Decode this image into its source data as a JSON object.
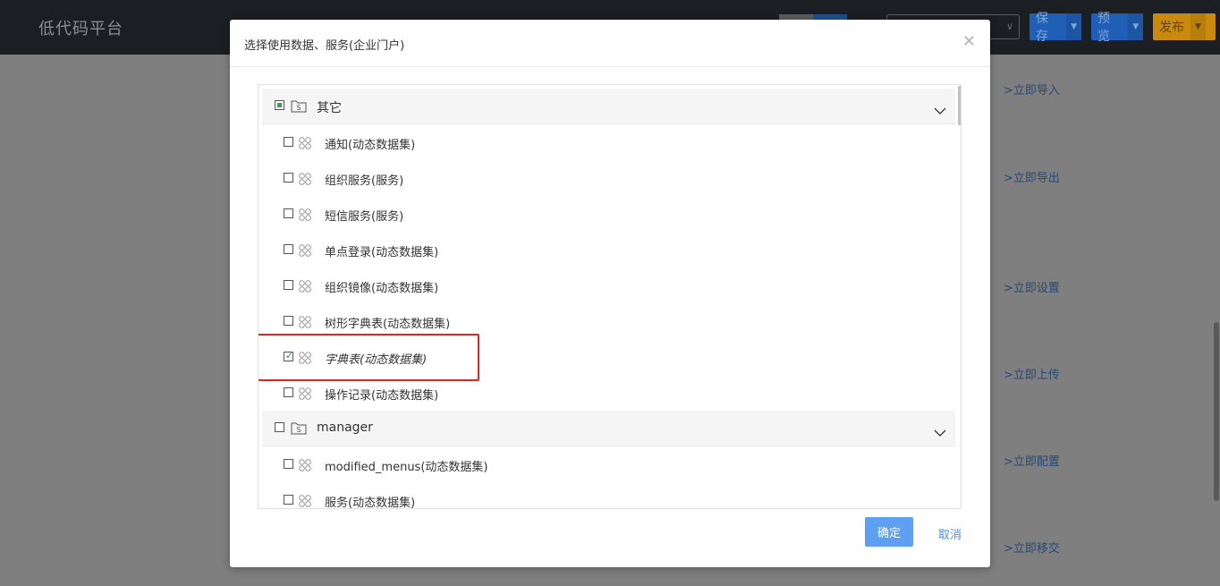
{
  "app": {
    "title": "低代码平台",
    "buttons": {
      "save": "保存",
      "preview": "预览",
      "publish": "发布"
    },
    "side_links": [
      "&gt;立即导入",
      "&gt;立即导出",
      "&gt;立即设置",
      "&gt;立即上传",
      "&gt;立即配置",
      "&gt;立即移交"
    ]
  },
  "modal": {
    "title": "选择使用数据、服务(企业门户)",
    "groups": [
      {
        "label": "其它",
        "state": "partial",
        "items": [
          {
            "label": "通知(动态数据集)",
            "checked": false
          },
          {
            "label": "组织服务(服务)",
            "checked": false
          },
          {
            "label": "短信服务(服务)",
            "checked": false
          },
          {
            "label": "单点登录(动态数据集)",
            "checked": false
          },
          {
            "label": "组织镜像(动态数据集)",
            "checked": false
          },
          {
            "label": "树形字典表(动态数据集)",
            "checked": false
          },
          {
            "label": "字典表(动态数据集)",
            "checked": true
          },
          {
            "label": "操作记录(动态数据集)",
            "checked": false
          }
        ]
      },
      {
        "label": "manager",
        "state": "unchecked",
        "items": [
          {
            "label": "modified_menus(动态数据集)",
            "checked": false
          },
          {
            "label": "服务(动态数据集)",
            "checked": false
          }
        ]
      }
    ],
    "confirm_label": "确定",
    "cancel_label": "取消"
  },
  "colors": {
    "topbar": "#1b1e23",
    "save_button": "#1f5fb5",
    "preview_button": "#1f5fb5",
    "publish_button": "#c98a0e",
    "confirm_button": "#5ea0ef",
    "highlight_box": "#e1251b",
    "link": "#4a90e2"
  }
}
